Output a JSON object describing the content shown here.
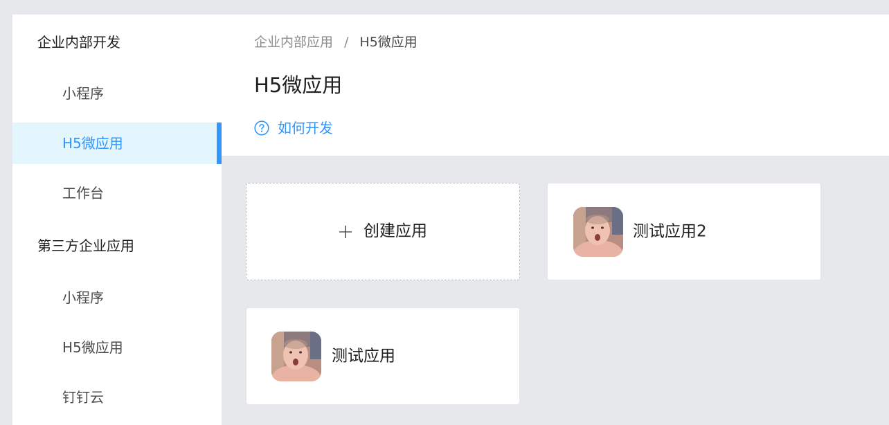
{
  "sidebar": {
    "groups": [
      {
        "title": "企业内部开发",
        "items": [
          {
            "label": "小程序",
            "active": false
          },
          {
            "label": "H5微应用",
            "active": true
          },
          {
            "label": "工作台",
            "active": false
          }
        ]
      },
      {
        "title": "第三方企业应用",
        "items": [
          {
            "label": "小程序",
            "active": false
          },
          {
            "label": "H5微应用",
            "active": false
          },
          {
            "label": "钉钉云",
            "active": false
          }
        ]
      }
    ]
  },
  "header": {
    "breadcrumb": {
      "parent": "企业内部应用",
      "separator": "/",
      "current": "H5微应用"
    },
    "title": "H5微应用",
    "help_link": "如何开发"
  },
  "cards": {
    "create_label": "创建应用",
    "apps": [
      {
        "name": "测试应用2",
        "icon": "app-avatar-photo"
      },
      {
        "name": "测试应用",
        "icon": "app-avatar-photo"
      }
    ]
  },
  "colors": {
    "accent": "#3296fa",
    "active_bg": "#e3f5fd",
    "page_bg": "#e7e8ec"
  }
}
